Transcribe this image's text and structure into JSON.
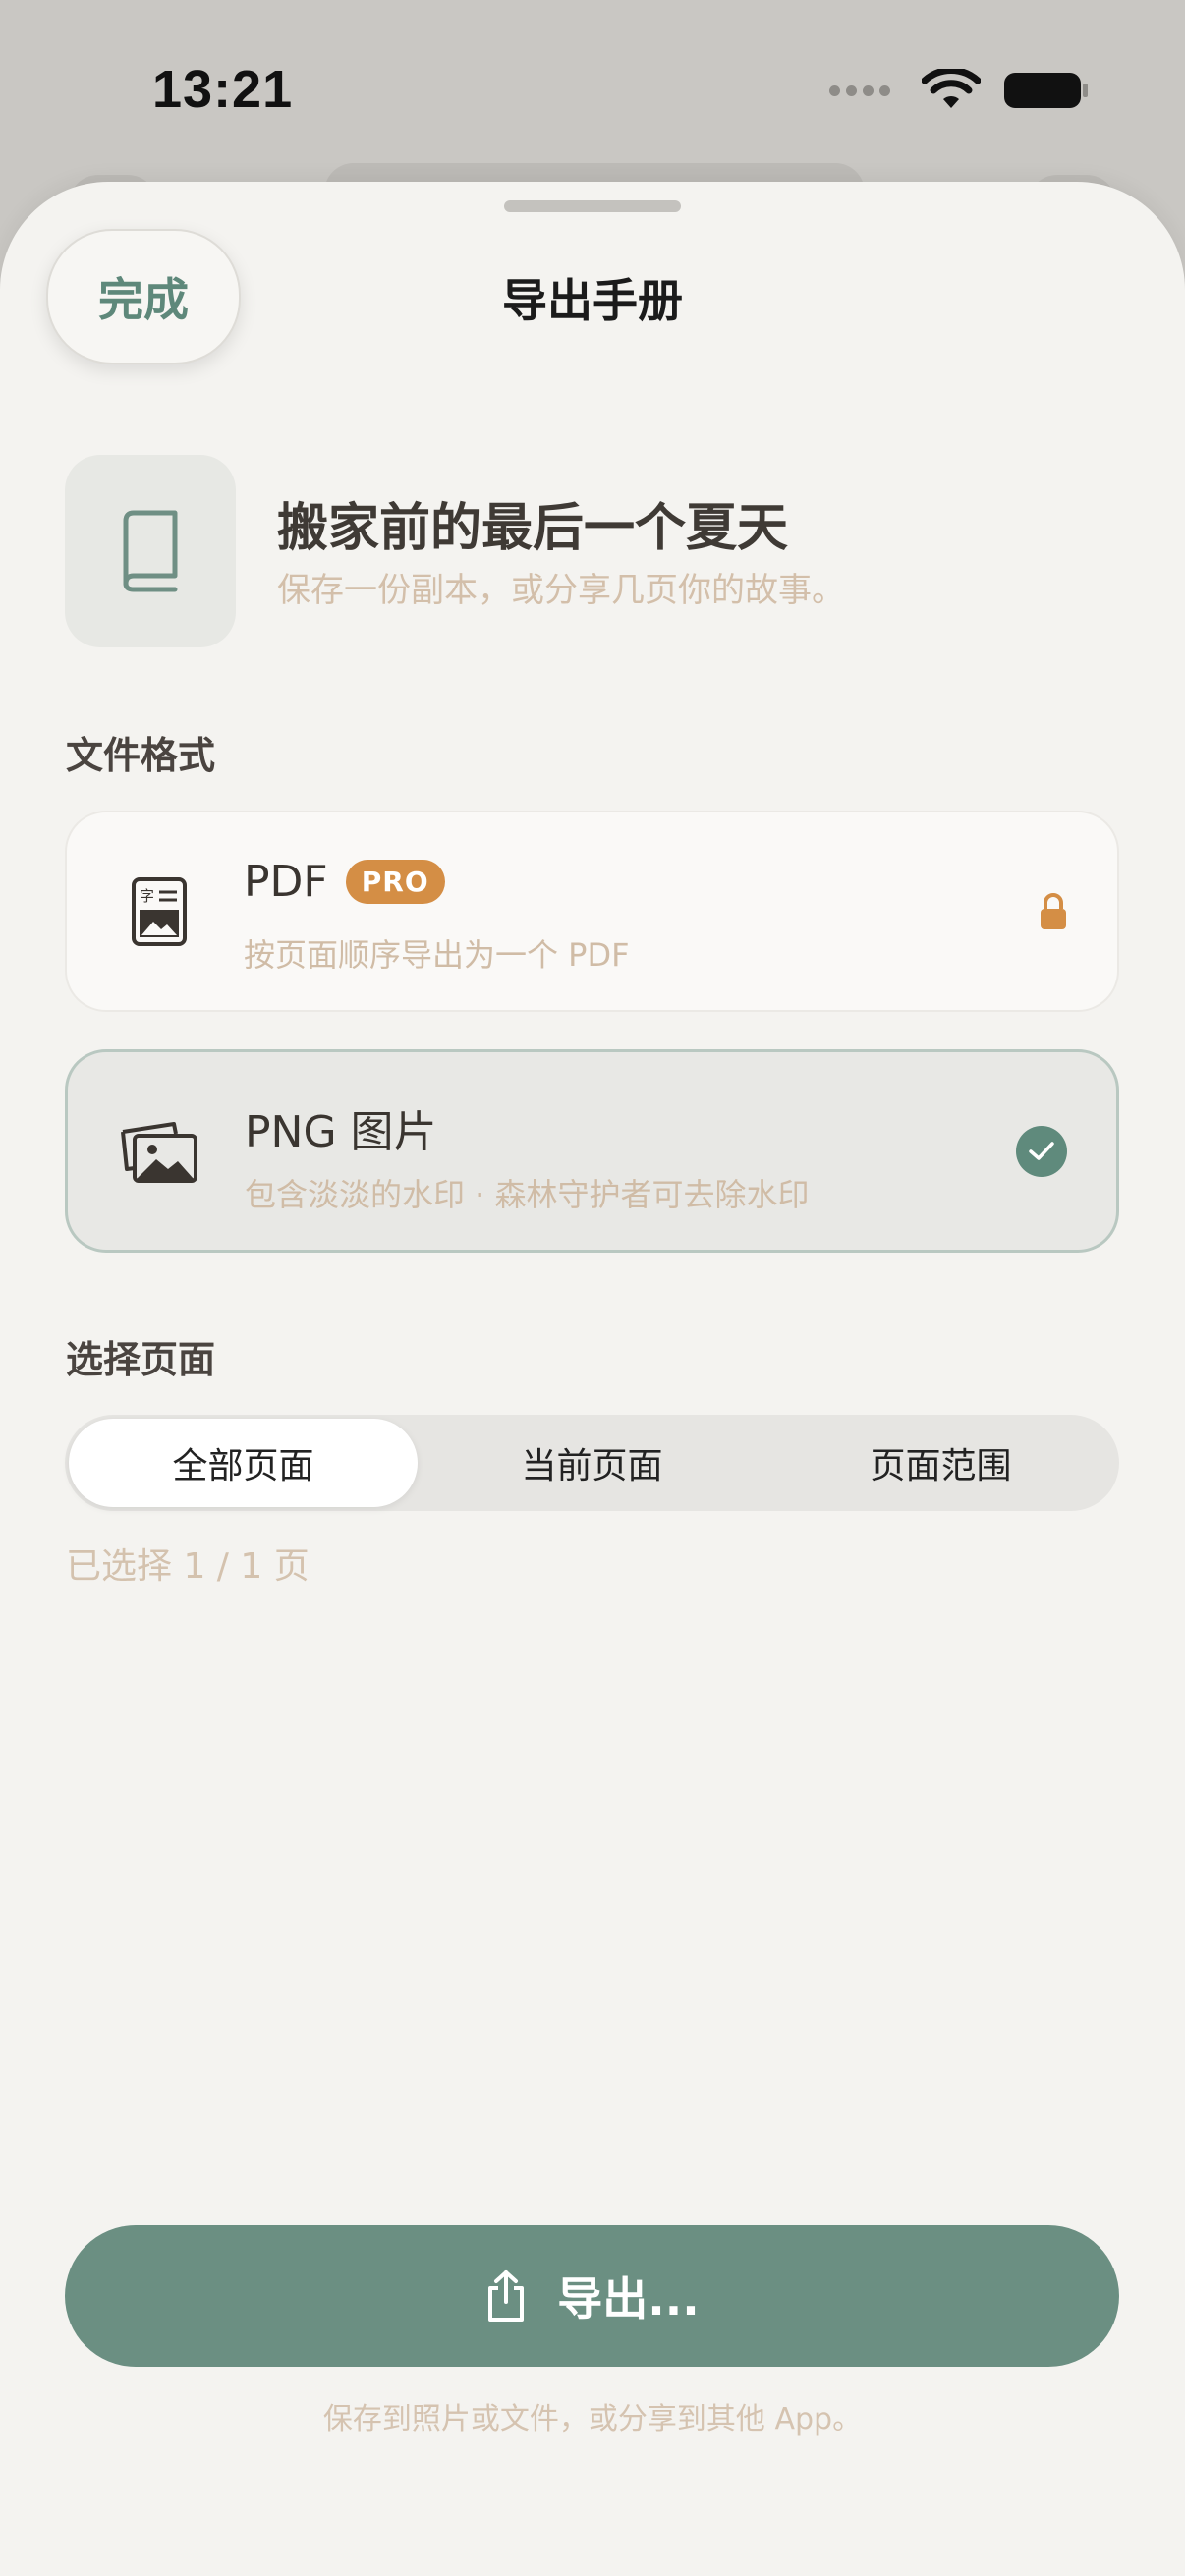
{
  "status_bar": {
    "time": "13:21"
  },
  "header": {
    "done_label": "完成",
    "title": "导出手册"
  },
  "book": {
    "title": "搬家前的最后一个夏天",
    "subtitle": "保存一份副本，或分享几页你的故事。"
  },
  "format_section": {
    "label": "文件格式",
    "options": [
      {
        "title": "PDF",
        "badge": "PRO",
        "subtitle": "按页面顺序导出为一个 PDF",
        "locked": true,
        "selected": false
      },
      {
        "title": "PNG 图片",
        "subtitle": "包含淡淡的水印 · 森林守护者可去除水印",
        "locked": false,
        "selected": true
      }
    ]
  },
  "pages_section": {
    "label": "选择页面",
    "segments": [
      "全部页面",
      "当前页面",
      "页面范围"
    ],
    "active_segment": "全部页面",
    "selected_text": "已选择 1 / 1 页"
  },
  "export": {
    "button_label": "导出...",
    "note": "保存到照片或文件，或分享到其他 App。"
  },
  "colors": {
    "accent": "#6b8f82",
    "pro_badge": "#d48e45",
    "sheet_bg": "#f4f3f0"
  }
}
